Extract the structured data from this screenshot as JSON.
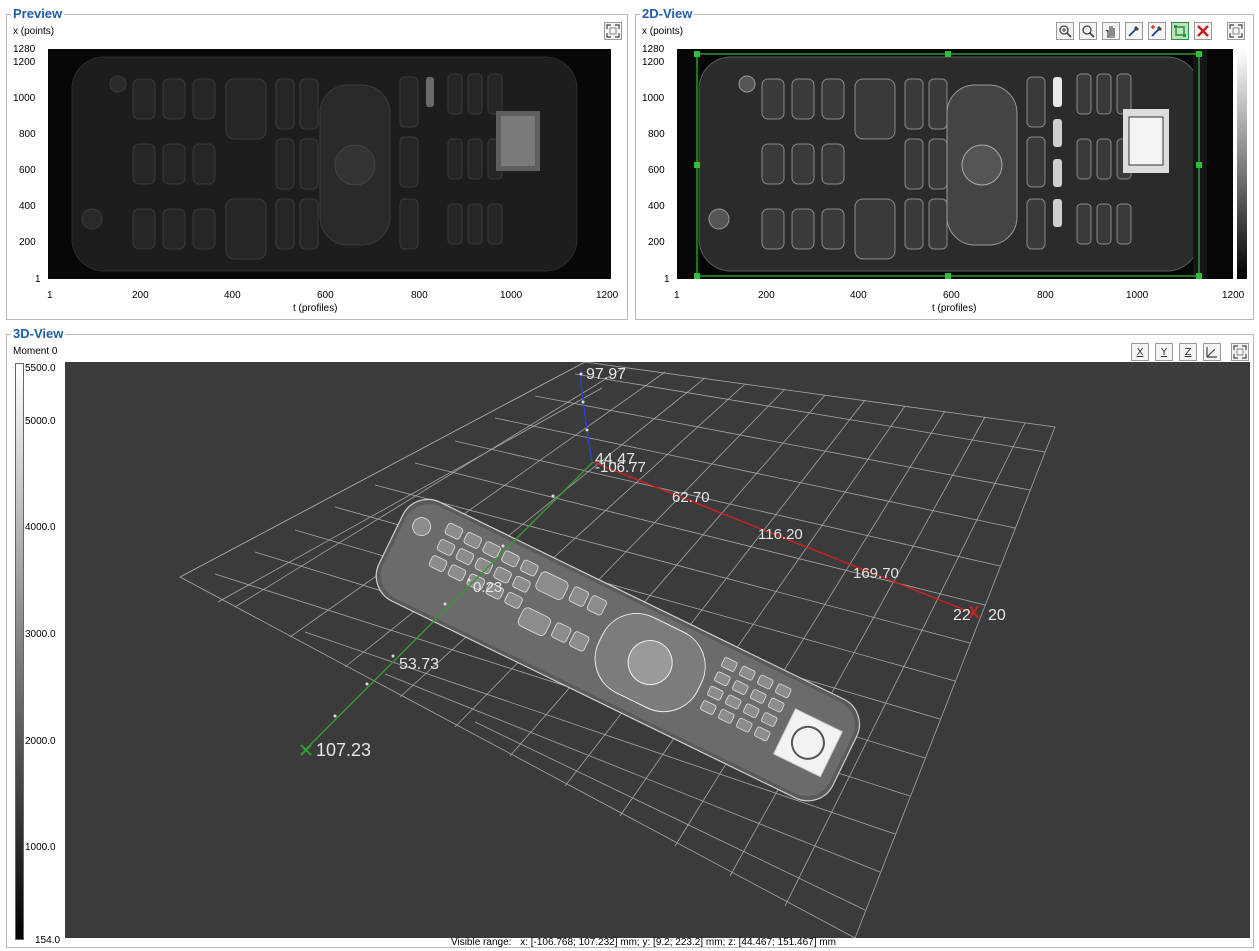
{
  "preview": {
    "title": "Preview",
    "y_caption": "x (points)",
    "x_caption": "t (profiles)",
    "y_ticks": [
      "1280",
      "1200",
      "1000",
      "800",
      "600",
      "400",
      "200",
      "1"
    ],
    "x_ticks": [
      "1",
      "200",
      "400",
      "600",
      "800",
      "1000",
      "1200"
    ]
  },
  "view2d": {
    "title": "2D-View",
    "y_caption": "x (points)",
    "x_caption": "t (profiles)",
    "y_ticks": [
      "1280",
      "1200",
      "1000",
      "800",
      "600",
      "400",
      "200",
      "1"
    ],
    "x_ticks": [
      "1",
      "200",
      "400",
      "600",
      "800",
      "1000",
      "1200"
    ],
    "toolbar": [
      "zoom-fit-icon",
      "zoom-icon",
      "pan-hand-icon",
      "pipette-icon",
      "pipette-plus-icon",
      "roi-select-icon",
      "roi-delete-icon",
      "fullscreen-icon"
    ]
  },
  "view3d": {
    "title": "3D-View",
    "scale_caption": "Moment 0",
    "scale_ticks": [
      "5500.0",
      "5000.0",
      "4000.0",
      "3000.0",
      "2000.0",
      "1000.0",
      "154.0"
    ],
    "toolbar": [
      "X",
      "Y",
      "Z",
      "iso-view-icon",
      "fullscreen-icon"
    ],
    "axis_labels": {
      "z_top": "97.97",
      "z_origin": "44.47",
      "x_start": "-106.77",
      "x1": "62.70",
      "x2": "116.20",
      "x3": "169.70",
      "x_end": "22",
      "x_end2": "20",
      "y1": "0.23",
      "y2": "53.73",
      "y3": "107.23"
    },
    "status_label": "Visible range:",
    "status_value": "x: [-106.768; 107.232] mm; y: [9.2; 223.2] mm; z: [44.467; 151.467] mm"
  },
  "colors": {
    "title_blue": "#1c5ea8",
    "x_axis": "#cc2222",
    "y_axis": "#2e9e2e",
    "z_axis": "#2b3fd0",
    "roi_green": "#2fbf3a"
  }
}
